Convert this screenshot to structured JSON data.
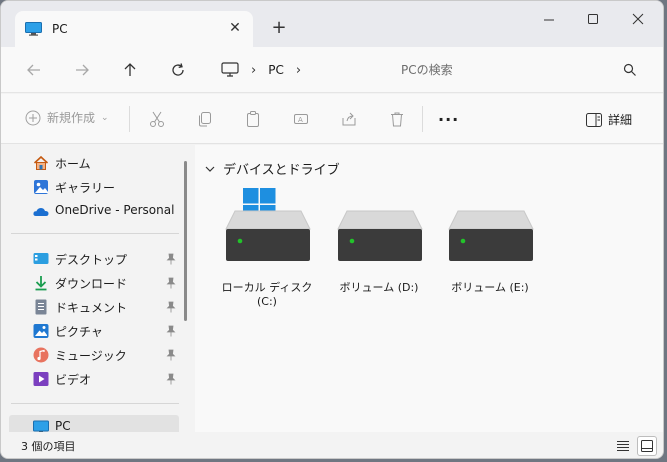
{
  "tab": {
    "title": "PC",
    "close_icon": "close-icon",
    "new_tab_icon": "plus-icon"
  },
  "window_controls": [
    "minimize-icon",
    "maximize-icon",
    "close-icon"
  ],
  "address": {
    "breadcrumb": [
      "PC"
    ],
    "search_placeholder": "PCの検索"
  },
  "toolbar": {
    "new_label": "新規作成",
    "details_label": "詳細",
    "more_label": "..."
  },
  "sidebar": {
    "quick": [
      {
        "label": "ホーム",
        "icon": "home-icon"
      },
      {
        "label": "ギャラリー",
        "icon": "gallery-icon"
      },
      {
        "label": "OneDrive - Personal",
        "icon": "onedrive-icon"
      }
    ],
    "pinned": [
      {
        "label": "デスクトップ",
        "icon": "desktop-icon"
      },
      {
        "label": "ダウンロード",
        "icon": "download-icon"
      },
      {
        "label": "ドキュメント",
        "icon": "document-icon"
      },
      {
        "label": "ピクチャ",
        "icon": "pictures-icon"
      },
      {
        "label": "ミュージック",
        "icon": "music-icon"
      },
      {
        "label": "ビデオ",
        "icon": "video-icon"
      }
    ],
    "this_pc": {
      "label": "PC",
      "icon": "pc-icon"
    }
  },
  "content": {
    "group_title": "デバイスとドライブ",
    "drives": [
      {
        "label": "ローカル ディスク (C:)",
        "system": true
      },
      {
        "label": "ボリューム (D:)",
        "system": false
      },
      {
        "label": "ボリューム (E:)",
        "system": false
      }
    ]
  },
  "status": {
    "item_count": "3 個の項目"
  },
  "colors": {
    "accent": "#0067c0",
    "drive_led": "#22c32a"
  }
}
